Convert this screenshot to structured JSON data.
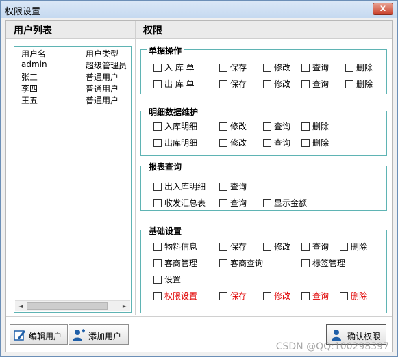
{
  "window": {
    "title": "权限设置",
    "close_glyph": "x"
  },
  "left_panel": {
    "title": "用户列表",
    "columns": [
      "用户名",
      "用户类型"
    ],
    "rows": [
      [
        "admin",
        "超级管理员"
      ],
      [
        "张三",
        "普通用户"
      ],
      [
        "李四",
        "普通用户"
      ],
      [
        "王五",
        "普通用户"
      ]
    ],
    "scroll_left_glyph": "◄",
    "scroll_right_glyph": "►"
  },
  "right_panel": {
    "title": "权限"
  },
  "groups": {
    "doc_ops": {
      "title": "单据操作",
      "row1": [
        "入 库 单",
        "保存",
        "修改",
        "查询",
        "删除"
      ],
      "row2": [
        "出 库 单",
        "保存",
        "修改",
        "查询",
        "删除"
      ]
    },
    "detail": {
      "title": "明细数据维护",
      "row1": [
        "入库明细",
        "修改",
        "查询",
        "删除"
      ],
      "row2": [
        "出库明细",
        "修改",
        "查询",
        "删除"
      ]
    },
    "report": {
      "title": "报表查询",
      "row1": [
        "出入库明细",
        "查询"
      ],
      "row2": [
        "收发汇总表",
        "查询",
        "显示金额"
      ]
    },
    "basic": {
      "title": "基础设置",
      "row1": [
        "物料信息",
        "保存",
        "修改",
        "查询",
        "删除"
      ],
      "row2": [
        "客商管理",
        "客商查询",
        "标签管理"
      ],
      "row3": [
        "设置"
      ],
      "row4": [
        "权限设置",
        "保存",
        "修改",
        "查询",
        "删除"
      ]
    }
  },
  "buttons": {
    "edit_user": "编辑用户",
    "add_user": "添加用户",
    "confirm": "确认权限"
  },
  "colors": {
    "group_border": "#5fb4b4",
    "highlight_text": "#e00000"
  },
  "watermark": "CSDN @QQ:100298397"
}
